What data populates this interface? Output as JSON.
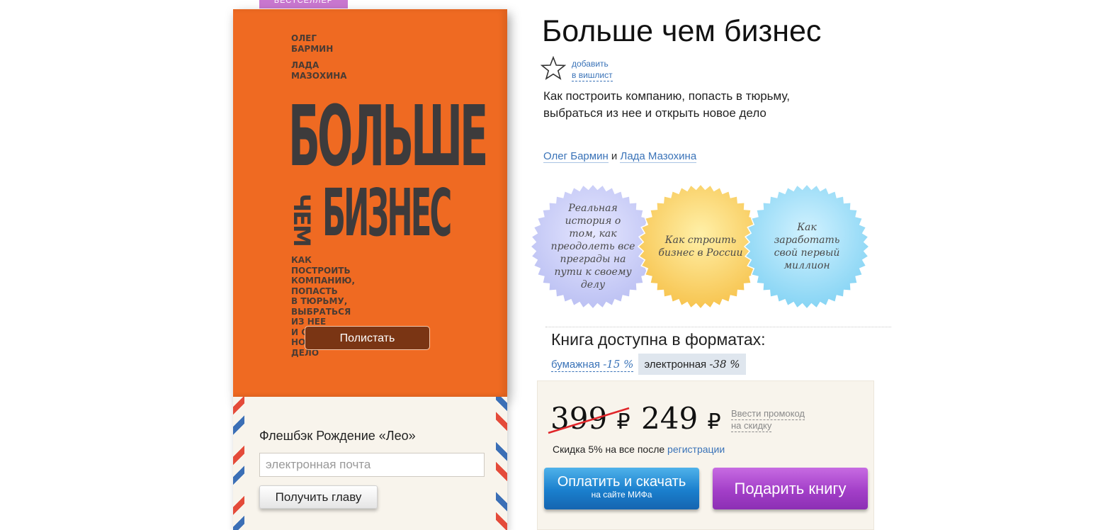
{
  "badge": "БЕСТСЕЛЛЕР",
  "cover": {
    "authors": [
      "ОЛЕГ",
      "БАРМИН",
      "ЛАДА",
      "МАЗОХИНА"
    ],
    "title_line1": "БОЛЬШЕ",
    "title_chem": "ЧЕМ",
    "title_line2": "БИЗНЕС",
    "tagline": [
      "КАК",
      "ПОСТРОИТЬ",
      "КОМПАНИЮ,",
      "ПОПАСТЬ",
      "В ТЮРЬМУ,",
      "ВЫБРАТЬСЯ",
      "ИЗ НЕЕ",
      "И ОТКРЫТЬ",
      "НОВОЕ",
      "ДЕЛО"
    ],
    "browse_button": "Полистать",
    "color": "#ef6a22"
  },
  "subscribe": {
    "title": "Флешбэк Рождение «Лео»",
    "email_placeholder": "электронная почта",
    "button": "Получить главу"
  },
  "book": {
    "title": "Больше чем бизнес",
    "wishlist": [
      "добавить",
      "в вишлист"
    ],
    "subtitle": "Как построить компанию, попасть в тюрьму, выбраться из нее и открыть новое дело",
    "author1": "Олег Бармин",
    "and": "и",
    "author2": "Лада Мазохина"
  },
  "seals": [
    {
      "text": "Реальная история о том, как преодолеть все преграды на пути к своему делу",
      "color": "#cfd2f8"
    },
    {
      "text": "Как строить бизнес в России",
      "color": "#fcd56e"
    },
    {
      "text": "Как заработать свой первый миллион",
      "color": "#9fdef7"
    }
  ],
  "formats": {
    "title": "Книга доступна в форматах:",
    "paper_label": "бумажная",
    "paper_discount": "-15 %",
    "ebook_label": "электронная",
    "ebook_discount": "-38 %"
  },
  "price": {
    "old": "399",
    "new": "249",
    "currency": "₽",
    "promo": [
      "Ввести промокод",
      "на скидку"
    ],
    "discount_text": "Скидка 5% на все после",
    "discount_link": "регистрации"
  },
  "buttons": {
    "pay": "Оплатить и скачать",
    "pay_sub": "на сайте МИФа",
    "gift": "Подарить книгу",
    "pay_color": "#1a7fcd",
    "gift_color": "#a33fc8"
  }
}
